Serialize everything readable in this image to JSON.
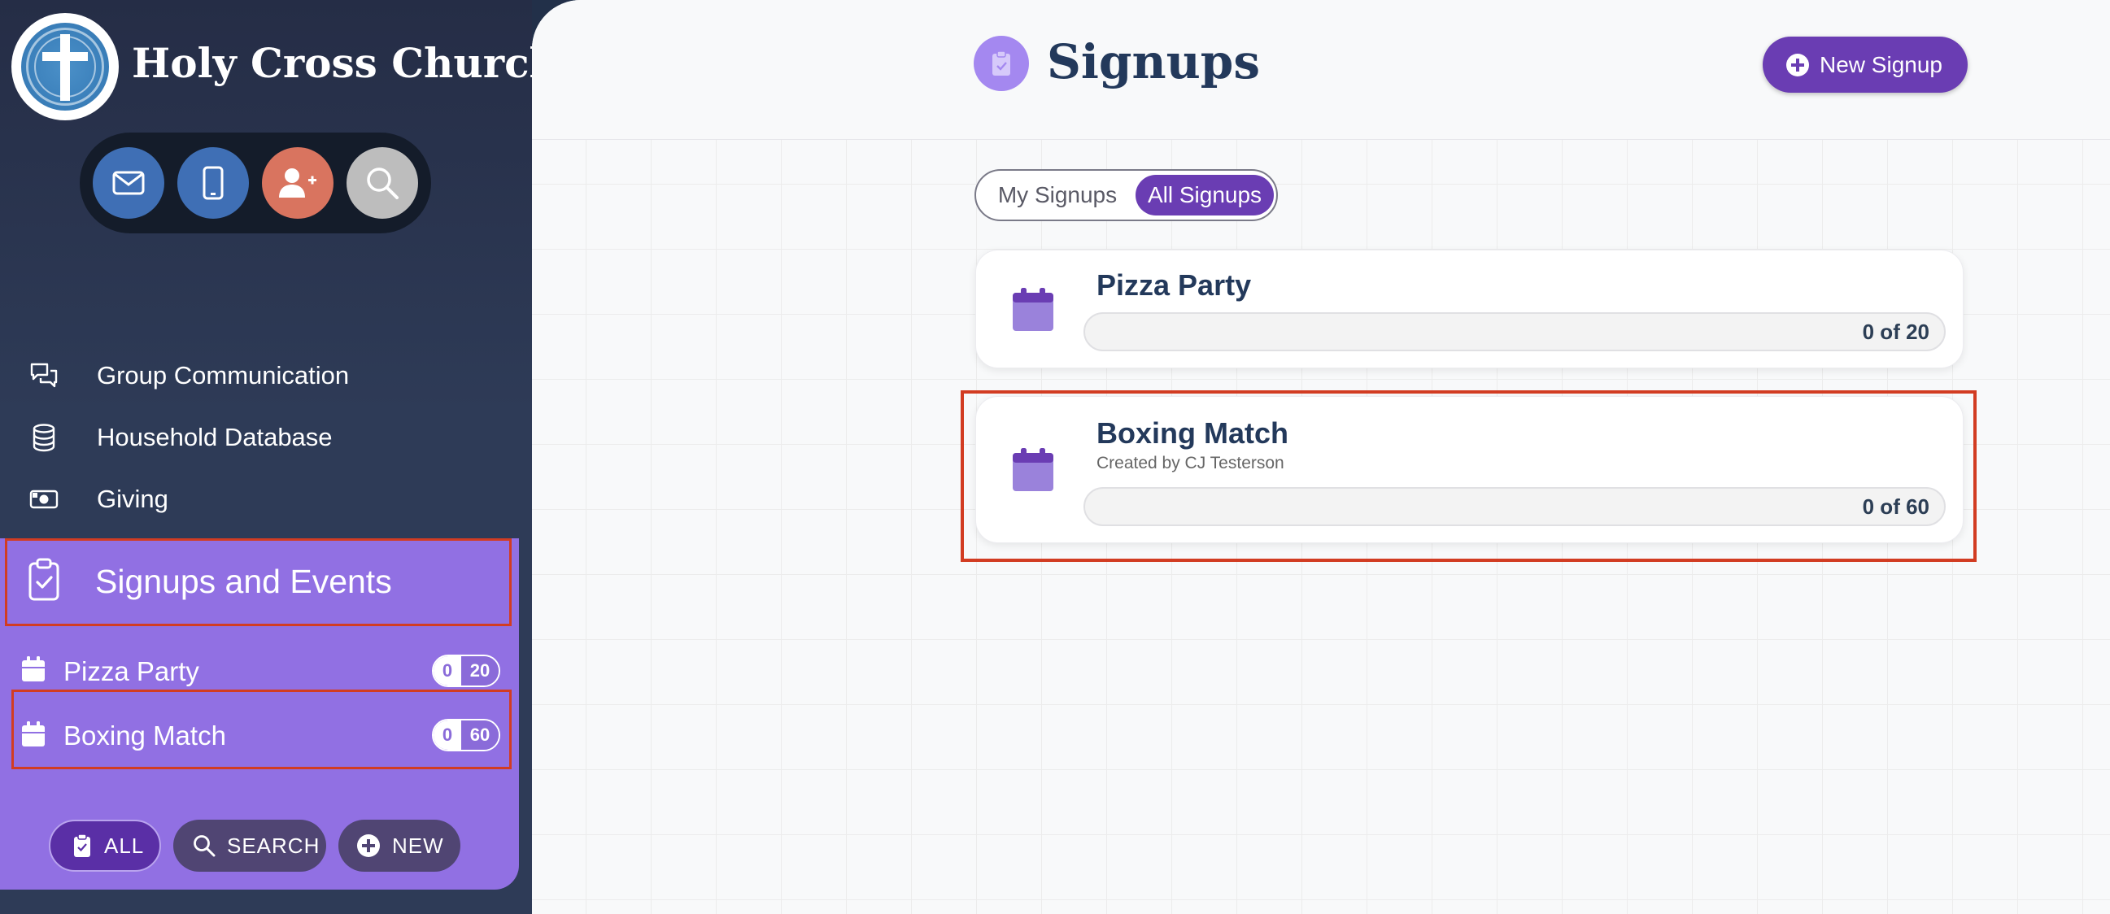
{
  "sidebar": {
    "app_title": "Holy Cross Church",
    "quick_actions": [
      {
        "icon": "envelope-icon",
        "color": "#3f6fb5"
      },
      {
        "icon": "phone-icon",
        "color": "#3f6fb5"
      },
      {
        "icon": "add-user-icon",
        "color": "#d9745f"
      },
      {
        "icon": "search-icon",
        "color": "#bdbdbd"
      }
    ],
    "nav": [
      {
        "label": "Group Communication",
        "icon": "chat-icon"
      },
      {
        "label": "Household Database",
        "icon": "database-icon"
      },
      {
        "label": "Giving",
        "icon": "money-icon"
      }
    ],
    "events": {
      "title": "Signups and Events",
      "items": [
        {
          "label": "Pizza Party",
          "filled": "0",
          "total": "20"
        },
        {
          "label": "Boxing Match",
          "filled": "0",
          "total": "60"
        }
      ],
      "buttons": {
        "all": "ALL",
        "search": "SEARCH",
        "new": "NEW"
      }
    }
  },
  "main": {
    "title": "Signups",
    "new_button": "New Signup",
    "toggle": {
      "mine": "My Signups",
      "all": "All Signups",
      "selected": "all"
    },
    "cards": [
      {
        "title": "Pizza Party",
        "subtitle": "",
        "progress_text": "0 of 20",
        "progress": 0
      },
      {
        "title": "Boxing Match",
        "subtitle": "Created by CJ Testerson",
        "progress_text": "0 of 60",
        "progress": 0
      }
    ]
  },
  "colors": {
    "accent": "#6a3db3",
    "panel": "#9170e3",
    "highlight": "#d23c22",
    "title_text": "#23395b"
  }
}
